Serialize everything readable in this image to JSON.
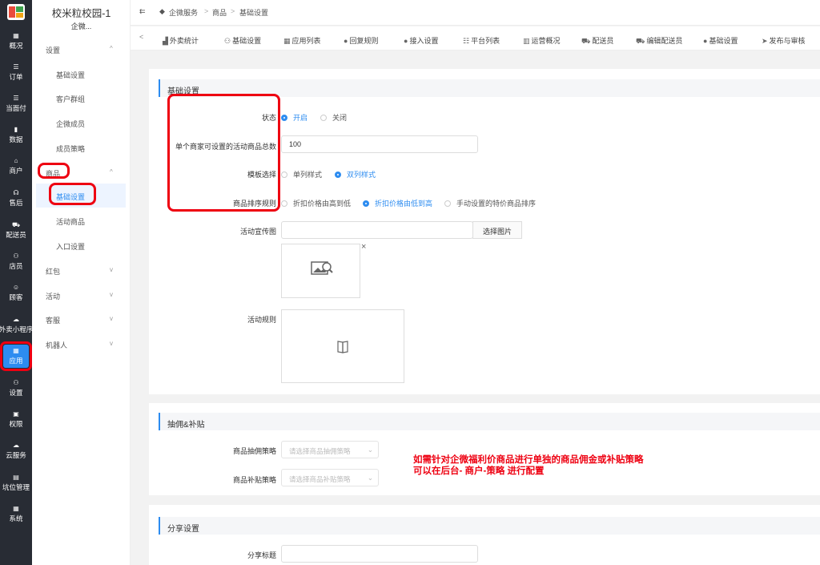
{
  "rail": {
    "items": [
      {
        "icon": "▦",
        "label": "概况"
      },
      {
        "icon": "☰",
        "label": "订单"
      },
      {
        "icon": "☰",
        "label": "当面付"
      },
      {
        "icon": "▮",
        "label": "数据"
      },
      {
        "icon": "⌂",
        "label": "商户"
      },
      {
        "icon": "☊",
        "label": "售后"
      },
      {
        "icon": "⛟",
        "label": "配送员"
      },
      {
        "icon": "⚇",
        "label": "店员"
      },
      {
        "icon": "☺",
        "label": "顾客"
      },
      {
        "icon": "☁",
        "label": "外卖小程序"
      },
      {
        "icon": "▦",
        "label": "应用"
      },
      {
        "icon": "⚇",
        "label": "设置"
      },
      {
        "icon": "▣",
        "label": "权限"
      },
      {
        "icon": "☁",
        "label": "云服务"
      },
      {
        "icon": "▤",
        "label": "坑位管理"
      },
      {
        "icon": "▦",
        "label": "系统"
      }
    ]
  },
  "sidebar": {
    "school_name": "校米粒校园-1",
    "school_sub": "企微...",
    "groups": [
      {
        "label": "设置",
        "chevron": "^"
      },
      {
        "label": "商品",
        "chevron": "^"
      },
      {
        "label": "红包",
        "chevron": "v"
      },
      {
        "label": "活动",
        "chevron": "v"
      },
      {
        "label": "客服",
        "chevron": "v"
      },
      {
        "label": "机器人",
        "chevron": "v"
      }
    ],
    "settings_items": [
      "基础设置",
      "客户群组",
      "企微成员",
      "成员策略"
    ],
    "goods_items": [
      "基础设置",
      "活动商品",
      "入口设置"
    ]
  },
  "topbar": {
    "collapse_icon": "⇇",
    "crumbs": [
      "企微服务",
      ">",
      "商品",
      ">",
      "基础设置"
    ]
  },
  "tabs": {
    "prev": "<",
    "items": [
      {
        "icon": "▟",
        "label": "外卖统计"
      },
      {
        "icon": "⚇",
        "label": "基础设置"
      },
      {
        "icon": "▦",
        "label": "应用列表"
      },
      {
        "icon": "●",
        "label": "回复规则"
      },
      {
        "icon": "●",
        "label": "接入设置"
      },
      {
        "icon": "☷",
        "label": "平台列表"
      },
      {
        "icon": "▥",
        "label": "运营概况"
      },
      {
        "icon": "⛟",
        "label": "配送员"
      },
      {
        "icon": "⛟",
        "label": "编辑配送员"
      },
      {
        "icon": "●",
        "label": "基础设置"
      },
      {
        "icon": "➤",
        "label": "发布与审核"
      }
    ]
  },
  "basic": {
    "title": "基础设置",
    "status_label": "状态",
    "status_on": "开启",
    "status_off": "关闭",
    "limit_label": "单个商家可设置的活动商品总数",
    "limit_value": "100",
    "template_label": "模板选择",
    "template_single": "单列样式",
    "template_double": "双列样式",
    "sort_label": "商品排序规则",
    "sort_high_low": "折扣价格由高到低",
    "sort_low_high": "折扣价格由低到高",
    "sort_manual": "手动设置的特价商品排序",
    "banner_label": "活动宣传图",
    "choose_image": "选择图片",
    "remove": "×",
    "rules_label": "活动规则"
  },
  "commission": {
    "title": "抽佣&补贴",
    "commission_label": "商品抽佣策略",
    "commission_placeholder": "请选择商品抽佣策略",
    "subsidy_label": "商品补贴策略",
    "subsidy_placeholder": "请选择商品补贴策略",
    "note_line1": "如需针对企微福利价商品进行单独的商品佣金或补贴策略",
    "note_line2": "可以在后台- 商户-策略 进行配置"
  },
  "share": {
    "title": "分享设置",
    "title_label": "分享标题"
  },
  "colors": {
    "accent": "#2d8cf0",
    "highlight": "#ee0011",
    "rail_bg": "#282c34"
  }
}
